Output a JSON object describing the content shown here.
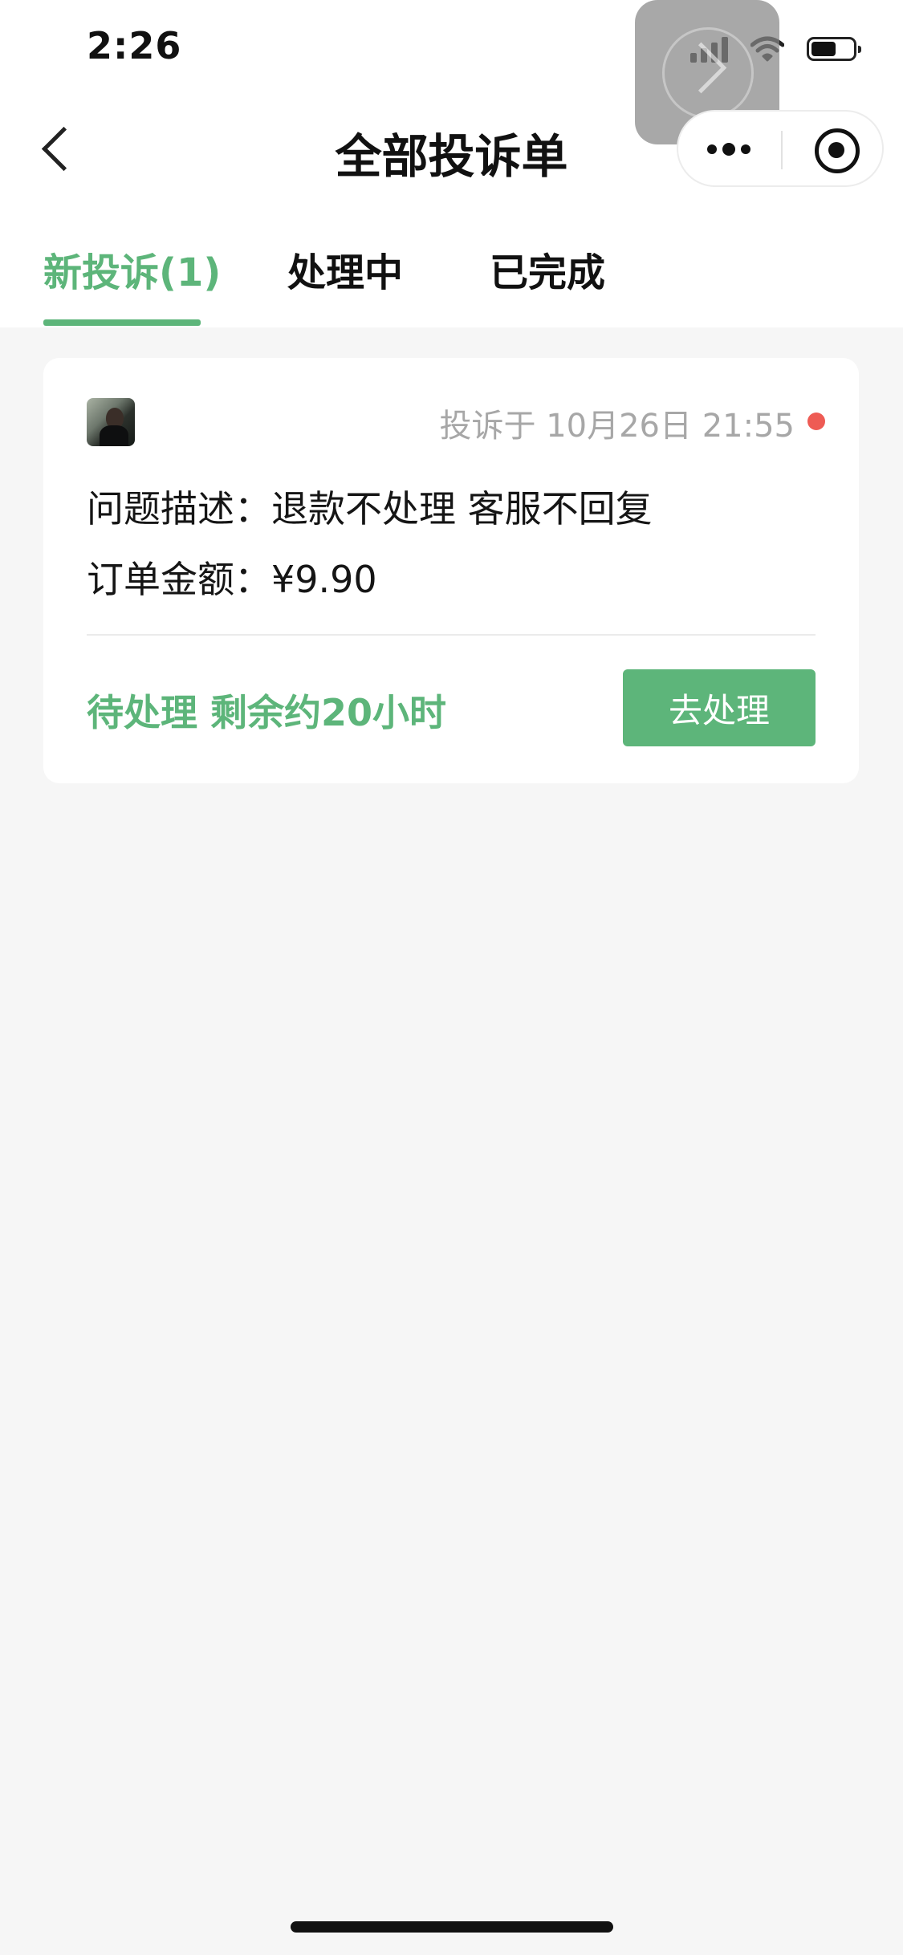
{
  "status_bar": {
    "time": "2:26"
  },
  "nav": {
    "title": "全部投诉单",
    "back_icon": "chevron-left-icon",
    "more_icon": "more-dots-icon",
    "close_icon": "mini-program-close-icon"
  },
  "tabs": [
    {
      "label": "新投诉(1)",
      "active": true
    },
    {
      "label": "处理中",
      "active": false
    },
    {
      "label": "已完成",
      "active": false
    }
  ],
  "complaint": {
    "time_text": "投诉于 10月26日 21:55",
    "unread_dot_color": "#ee5b54",
    "description_label": "问题描述：",
    "description_value": "退款不处理 客服不回复",
    "amount_label": "订单金额：",
    "amount_value": "¥9.90",
    "status_text": "待处理 剩余约20小时",
    "action_label": "去处理"
  },
  "colors": {
    "accent": "#5db57a",
    "background": "#f6f6f6"
  }
}
